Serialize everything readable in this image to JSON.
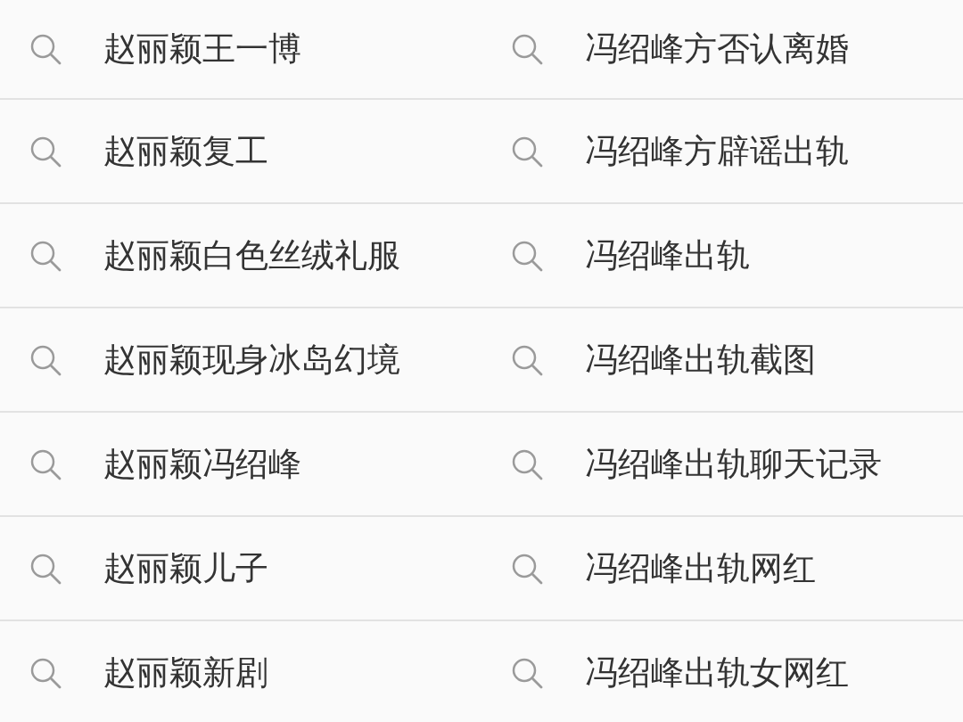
{
  "columns": [
    {
      "suggestions": [
        "赵丽颖王一博",
        "赵丽颖复工",
        "赵丽颖白色丝绒礼服",
        "赵丽颖现身冰岛幻境",
        "赵丽颖冯绍峰",
        "赵丽颖儿子",
        "赵丽颖新剧"
      ]
    },
    {
      "suggestions": [
        "冯绍峰方否认离婚",
        "冯绍峰方辟谣出轨",
        "冯绍峰出轨",
        "冯绍峰出轨截图",
        "冯绍峰出轨聊天记录",
        "冯绍峰出轨网红",
        "冯绍峰出轨女网红"
      ]
    }
  ]
}
